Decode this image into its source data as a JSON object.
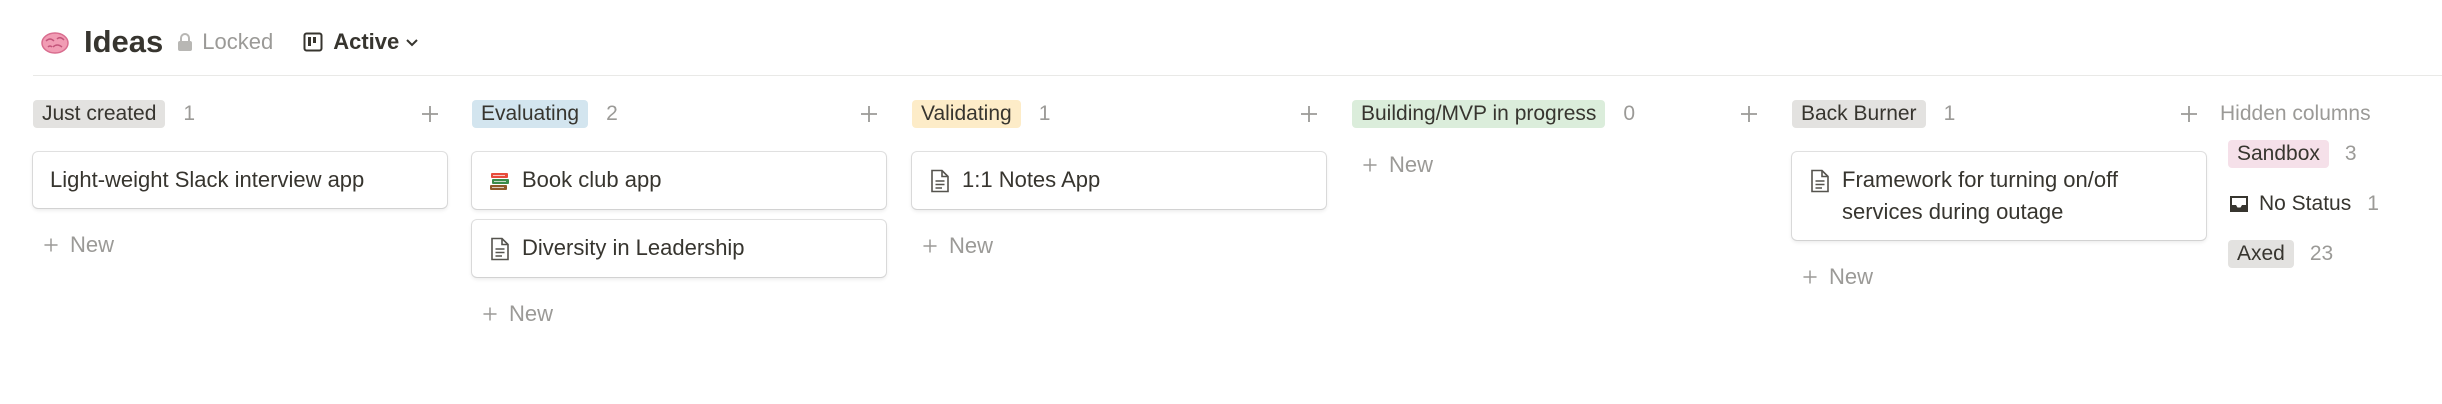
{
  "header": {
    "title": "Ideas",
    "locked_label": "Locked",
    "view_label": "Active"
  },
  "columns": [
    {
      "label": "Just created",
      "count": "1",
      "tag_color": "#e3e2e0",
      "cards": [
        {
          "text": "Light-weight Slack interview app",
          "icon": "none"
        }
      ],
      "new_label": "New"
    },
    {
      "label": "Evaluating",
      "count": "2",
      "tag_color": "#d3e5ef",
      "cards": [
        {
          "text": "Book club app",
          "icon": "books-icon"
        },
        {
          "text": "Diversity in Leadership",
          "icon": "page-icon"
        }
      ],
      "new_label": "New"
    },
    {
      "label": "Validating",
      "count": "1",
      "tag_color": "#fdecc8",
      "cards": [
        {
          "text": "1:1 Notes App",
          "icon": "page-icon"
        }
      ],
      "new_label": "New"
    },
    {
      "label": "Building/MVP in progress",
      "count": "0",
      "tag_color": "#dbeddb",
      "cards": [],
      "new_label": "New"
    },
    {
      "label": "Back Burner",
      "count": "1",
      "tag_color": "#e3e2e0",
      "cards": [
        {
          "text": "Framework for turning on/off services during outage",
          "icon": "page-icon"
        }
      ],
      "new_label": "New"
    }
  ],
  "hidden_columns": {
    "title": "Hidden columns",
    "items": [
      {
        "label": "Sandbox",
        "count": "3",
        "tag_color": "#f5e0e9",
        "icon": "none"
      },
      {
        "label": "No Status",
        "count": "1",
        "tag_color": "transparent",
        "icon": "inbox-icon"
      },
      {
        "label": "Axed",
        "count": "23",
        "tag_color": "#e3e2e0",
        "icon": "none"
      }
    ]
  }
}
